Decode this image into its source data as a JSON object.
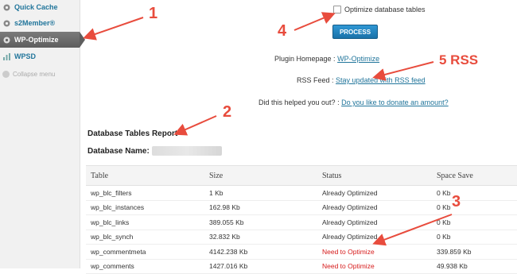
{
  "sidebar": {
    "items": [
      {
        "label": "Quick Cache",
        "icon": "gear-icon"
      },
      {
        "label": "s2Member®",
        "icon": "gear-icon"
      },
      {
        "label": "WP-Optimize",
        "icon": "gear-icon",
        "active": true
      },
      {
        "label": "WPSD",
        "icon": "chart-icon"
      }
    ],
    "collapse_label": "Collapse menu"
  },
  "optimize": {
    "checkbox_label": "Optimize database tables",
    "process_label": "PROCESS"
  },
  "info": {
    "homepage_label": "Plugin Homepage :",
    "homepage_link": "WP-Optimize",
    "rss_label": "RSS Feed :",
    "rss_link": "Stay updated with RSS feed",
    "donate_label": "Did this helped you out? :",
    "donate_link": "Do you like to donate an amount?"
  },
  "report": {
    "title": "Database Tables Report",
    "db_label": "Database Name:"
  },
  "table": {
    "headers": [
      "Table",
      "Size",
      "Status",
      "Space Save"
    ],
    "rows": [
      {
        "name": "wp_blc_filters",
        "size": "1 Kb",
        "status": "Already Optimized",
        "save": "0 Kb"
      },
      {
        "name": "wp_blc_instances",
        "size": "162.98 Kb",
        "status": "Already Optimized",
        "save": "0 Kb"
      },
      {
        "name": "wp_blc_links",
        "size": "389.055 Kb",
        "status": "Already Optimized",
        "save": "0 Kb"
      },
      {
        "name": "wp_blc_synch",
        "size": "32.832 Kb",
        "status": "Already Optimized",
        "save": "0 Kb"
      },
      {
        "name": "wp_commentmeta",
        "size": "4142.238 Kb",
        "status": "Need to Optimize",
        "save": "339.859 Kb"
      },
      {
        "name": "wp_comments",
        "size": "1427.016 Kb",
        "status": "Need to Optimize",
        "save": "49.938 Kb"
      }
    ]
  },
  "annotations": {
    "n1": "1",
    "n2": "2",
    "n3": "3",
    "n4": "4",
    "n5": "5 RSS",
    "color": "#e84c3d"
  }
}
